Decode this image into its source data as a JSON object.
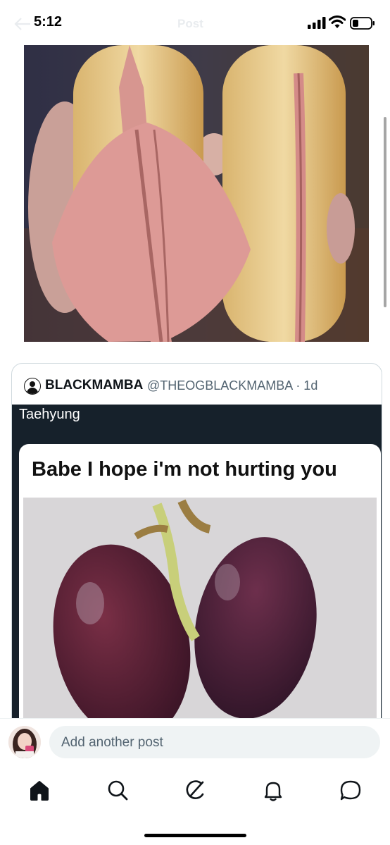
{
  "status_bar": {
    "time": "5:12",
    "signal_icon": "cellular-signal-icon",
    "wifi_icon": "wifi-icon",
    "battery_icon": "battery-icon"
  },
  "header": {
    "title": "Post",
    "back_icon": "arrow-left-icon"
  },
  "post": {
    "image_description_icon": "photo"
  },
  "quote": {
    "name": "BLACKMAMBA",
    "handle_time": "@THEOGBLACKMAMBA · 1d",
    "caption": "Taehyung",
    "meme_text": "Babe I hope i'm not hurting you"
  },
  "compose": {
    "placeholder": "Add another post"
  },
  "tabs": [
    {
      "name": "home",
      "icon": "home-icon"
    },
    {
      "name": "search",
      "icon": "search-icon"
    },
    {
      "name": "grok",
      "icon": "grok-icon"
    },
    {
      "name": "notifications",
      "icon": "bell-icon"
    },
    {
      "name": "messages",
      "icon": "chat-bubble-icon"
    }
  ]
}
